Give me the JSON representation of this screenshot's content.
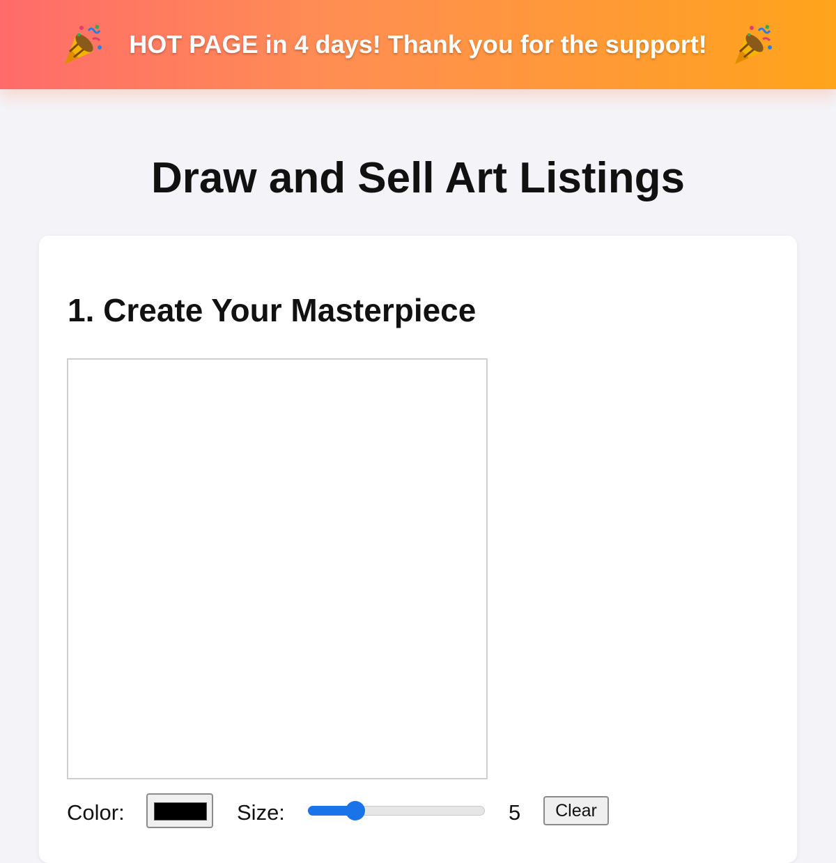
{
  "banner": {
    "text": "HOT PAGE in 4 days! Thank you for the support!",
    "icon": "party-popper-icon",
    "gradient_start": "#ff6b6b",
    "gradient_end": "#ffa41b"
  },
  "page": {
    "title": "Draw and Sell Art Listings",
    "background": "#f4f4f8"
  },
  "section": {
    "title": "1. Create Your Masterpiece"
  },
  "controls": {
    "color_label": "Color:",
    "color_value": "#000000",
    "size_label": "Size:",
    "size_value": "5",
    "size_fraction": 0.24,
    "slider_accent": "#1a73e8",
    "clear_label": "Clear"
  }
}
